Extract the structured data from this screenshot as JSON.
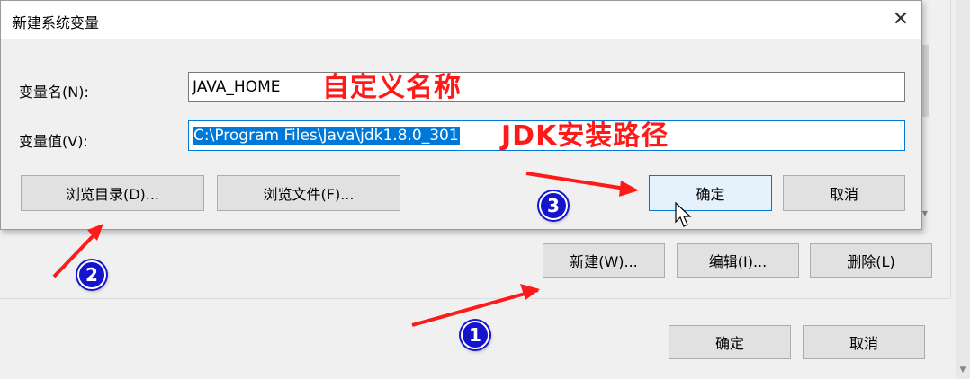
{
  "background": {
    "buttons": {
      "new": "新建(W)...",
      "edit": "编辑(I)...",
      "delete": "删除(L)",
      "ok": "确定",
      "cancel": "取消"
    }
  },
  "dialog": {
    "title": "新建系统变量",
    "close_glyph": "✕",
    "name_label": "变量名(N):",
    "name_value": "JAVA_HOME",
    "value_label": "变量值(V):",
    "value_value": "C:\\Program Files\\Java\\jdk1.8.0_301",
    "browse_dir": "浏览目录(D)...",
    "browse_file": "浏览文件(F)...",
    "ok": "确定",
    "cancel": "取消"
  },
  "annotations": {
    "name_note": "自定义名称",
    "value_note": "JDK安装路径",
    "badges": [
      "1",
      "2",
      "3"
    ],
    "color": "#ff1a1a",
    "badge_color": "#1414cc"
  }
}
